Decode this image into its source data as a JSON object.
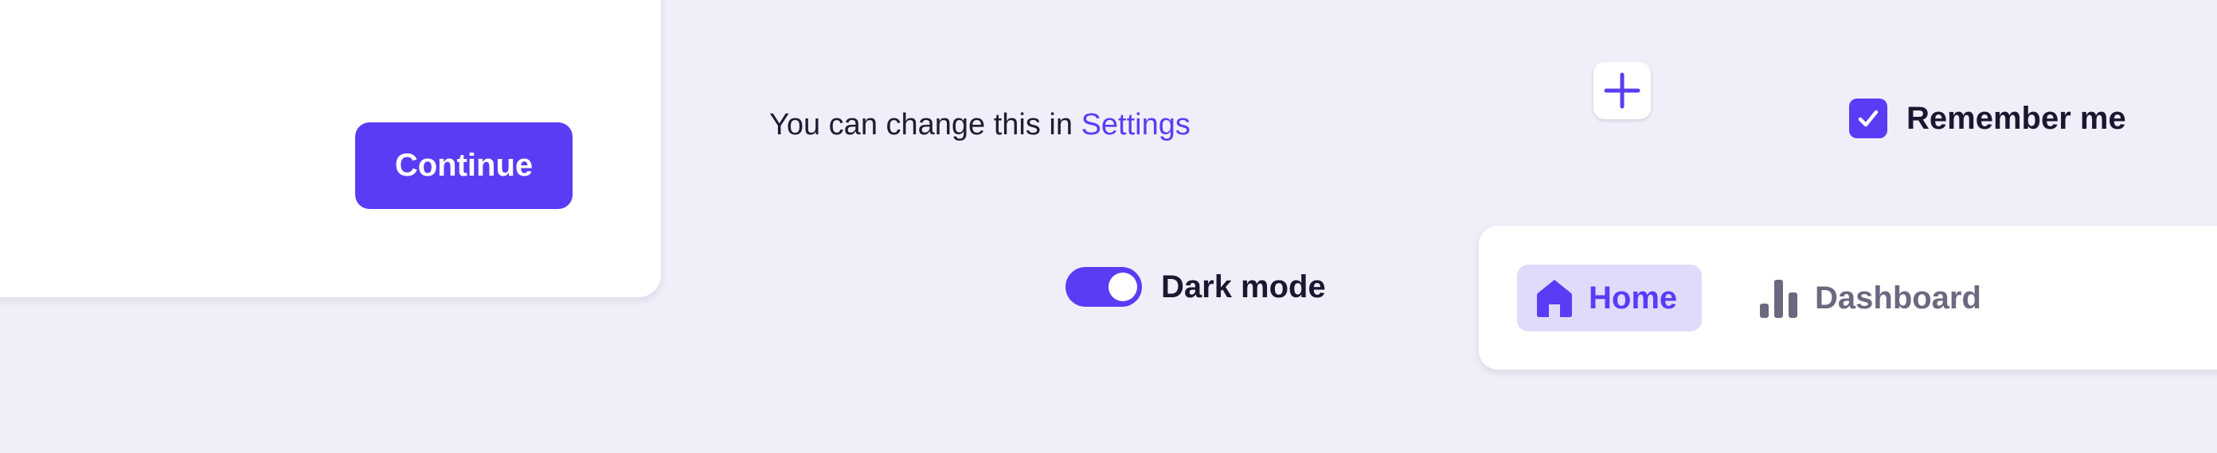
{
  "dialog": {
    "continue_label": "Continue"
  },
  "helper": {
    "text": "You can change this in ",
    "link_label": "Settings"
  },
  "add_button": {
    "icon": "plus-icon"
  },
  "remember": {
    "label": "Remember me",
    "checked": true
  },
  "dark_mode": {
    "label": "Dark mode",
    "enabled": true
  },
  "nav": {
    "items": [
      {
        "label": "Home",
        "icon": "home-icon",
        "active": true
      },
      {
        "label": "Dashboard",
        "icon": "bar-chart-icon",
        "active": false
      }
    ]
  },
  "colors": {
    "accent": "#5a3cf4",
    "accent_soft": "#dfdbfb",
    "background": "#f0eef8",
    "muted_text": "#6b6880"
  }
}
